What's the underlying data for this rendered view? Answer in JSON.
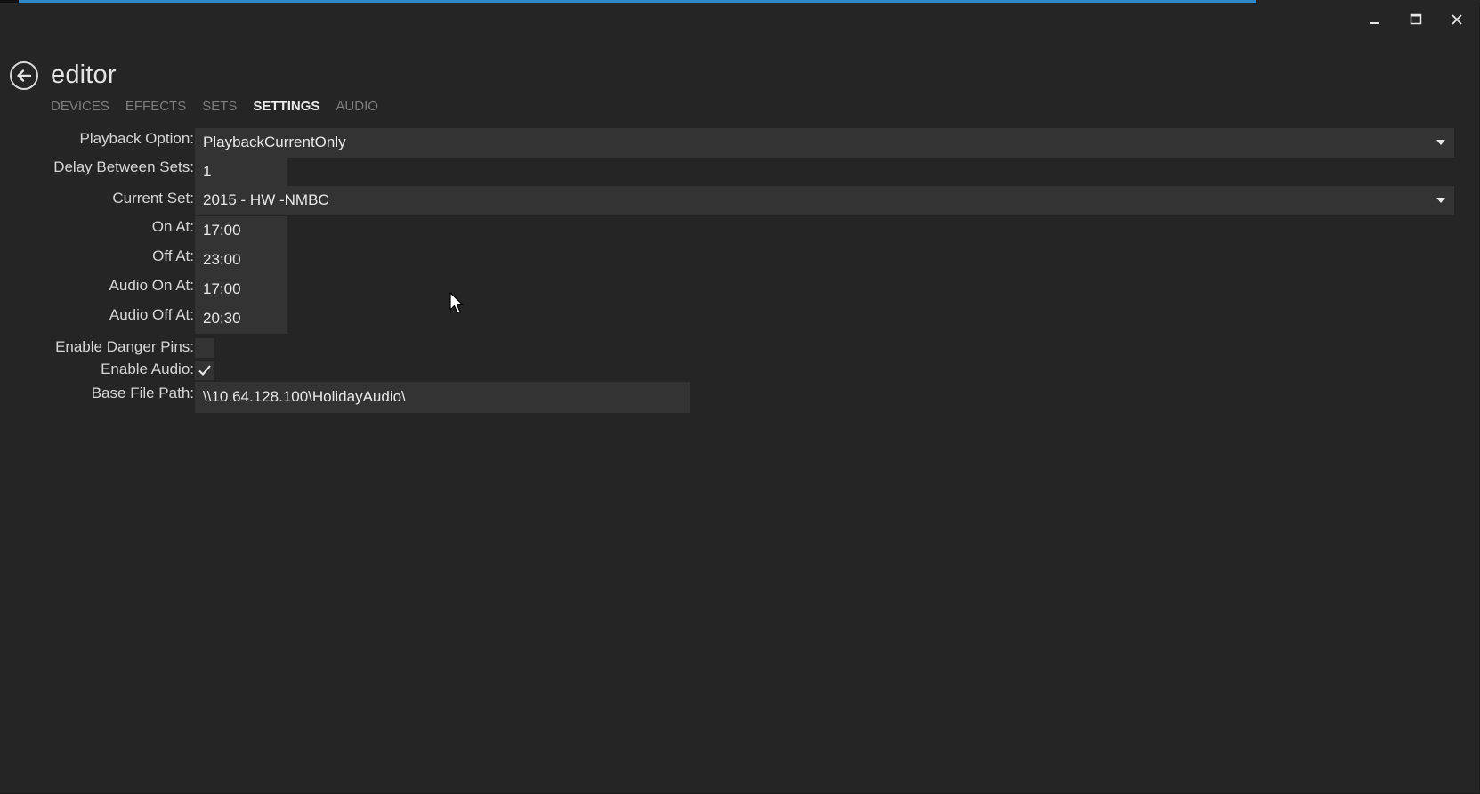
{
  "window": {
    "controls": {
      "minimize_icon": "minimize-icon",
      "maximize_icon": "maximize-icon",
      "close_icon": "close-icon"
    },
    "accent_color": "#2f88c8"
  },
  "header": {
    "title": "editor",
    "back_icon": "back-arrow-icon"
  },
  "tabs": [
    {
      "label": "DEVICES",
      "active": false
    },
    {
      "label": "EFFECTS",
      "active": false
    },
    {
      "label": "SETS",
      "active": false
    },
    {
      "label": "SETTINGS",
      "active": true
    },
    {
      "label": "AUDIO",
      "active": false
    }
  ],
  "settings": {
    "playback_option": {
      "label": "Playback Option:",
      "value": "PlaybackCurrentOnly"
    },
    "delay_between_sets": {
      "label": "Delay Between Sets:",
      "value": "1"
    },
    "current_set": {
      "label": "Current Set:",
      "value": "2015 - HW -NMBC"
    },
    "on_at": {
      "label": "On At:",
      "value": "17:00"
    },
    "off_at": {
      "label": "Off At:",
      "value": "23:00"
    },
    "audio_on_at": {
      "label": "Audio On At:",
      "value": "17:00"
    },
    "audio_off_at": {
      "label": "Audio Off At:",
      "value": "20:30"
    },
    "enable_danger_pins": {
      "label": "Enable Danger Pins:",
      "checked": false
    },
    "enable_audio": {
      "label": "Enable Audio:",
      "checked": true
    },
    "base_file_path": {
      "label": "Base File Path:",
      "value": "\\\\10.64.128.100\\HolidayAudio\\"
    }
  }
}
